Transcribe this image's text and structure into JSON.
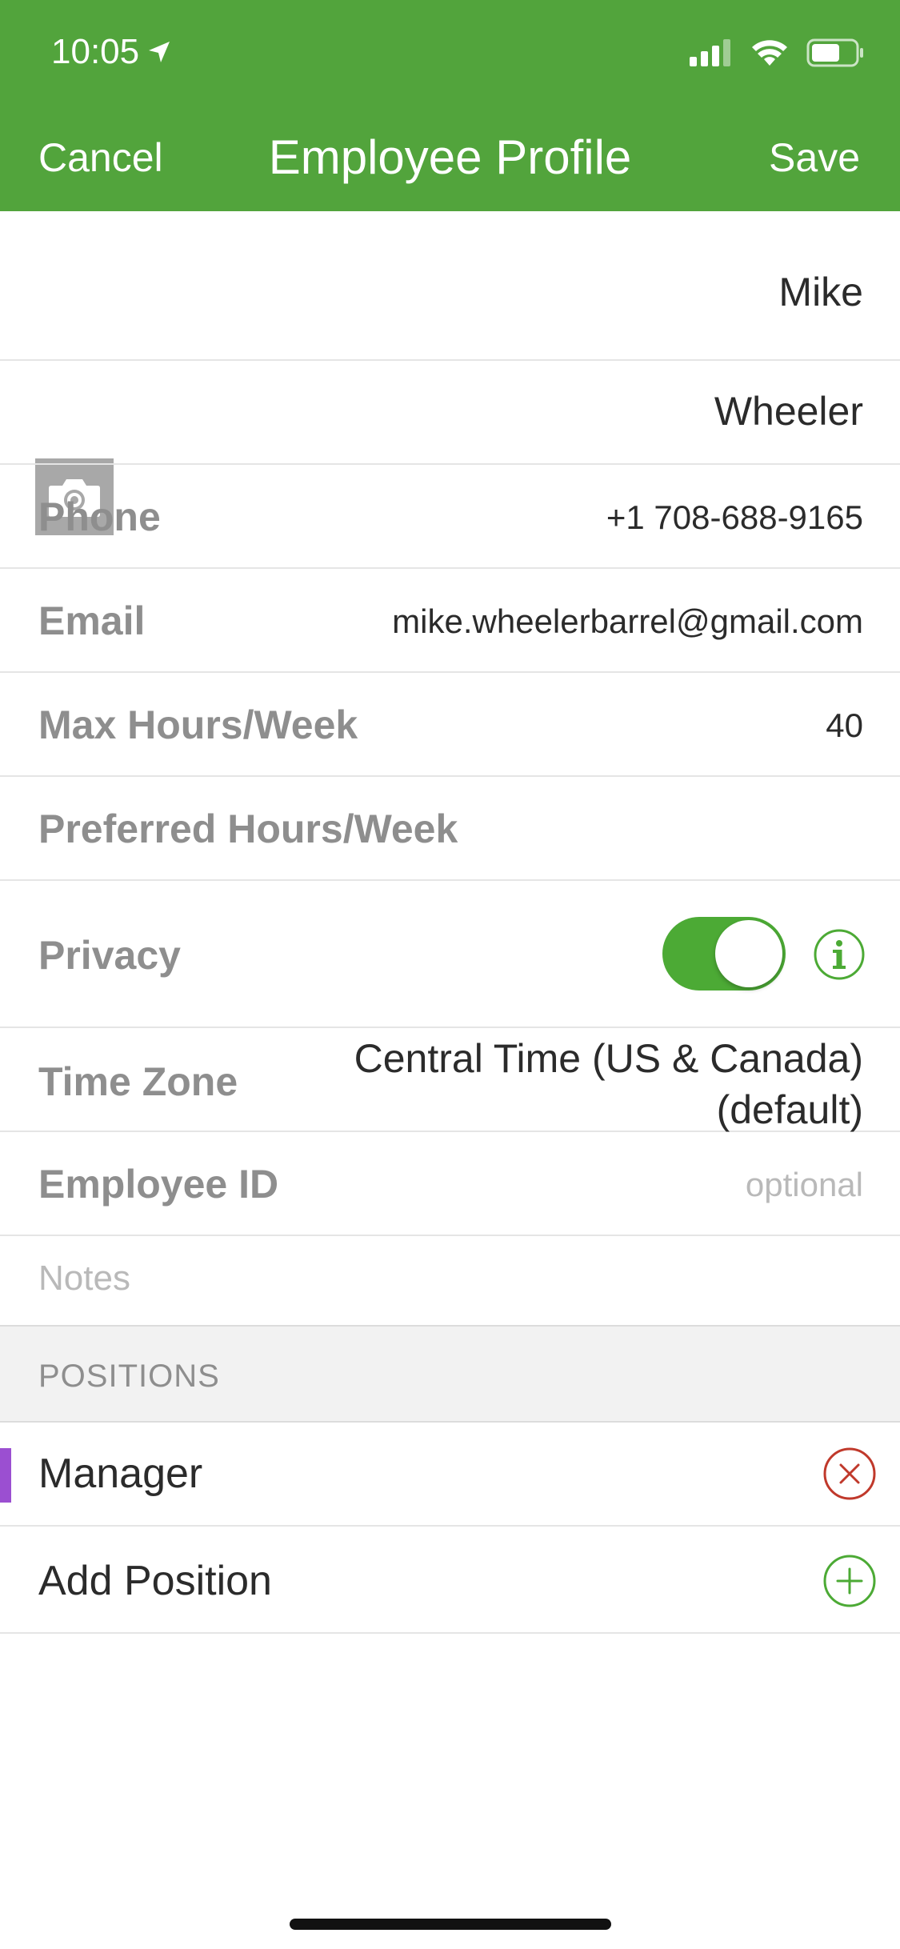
{
  "status_bar": {
    "time": "10:05"
  },
  "nav": {
    "cancel": "Cancel",
    "title": "Employee Profile",
    "save": "Save"
  },
  "profile": {
    "first_name": "Mike",
    "last_name": "Wheeler",
    "phone": {
      "label": "Phone",
      "value": "+1 708-688-9165"
    },
    "email": {
      "label": "Email",
      "value": "mike.wheelerbarrel@gmail.com"
    },
    "max_hours": {
      "label": "Max Hours/Week",
      "value": "40"
    },
    "preferred_hours": {
      "label": "Preferred Hours/Week",
      "value": ""
    },
    "privacy": {
      "label": "Privacy",
      "enabled": true
    },
    "time_zone": {
      "label": "Time Zone",
      "value_line1": "Central Time (US & Canada)",
      "value_line2": "(default)"
    },
    "employee_id": {
      "label": "Employee ID",
      "placeholder": "optional"
    },
    "notes": {
      "placeholder": "Notes"
    }
  },
  "positions": {
    "header": "POSITIONS",
    "items": [
      {
        "name": "Manager",
        "color": "#9b4fd1"
      }
    ],
    "add_label": "Add Position"
  },
  "colors": {
    "header_green": "#52a43c",
    "toggle_green": "#4caa35",
    "remove_red": "#c0392b",
    "add_green": "#4caa35"
  }
}
